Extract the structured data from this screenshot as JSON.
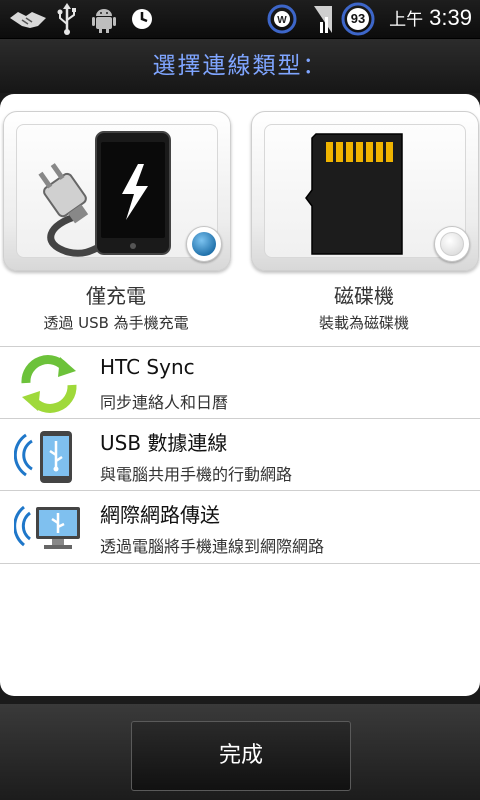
{
  "status_bar": {
    "battery_level": "93",
    "ampm": "上午",
    "time": "3:39",
    "icons": [
      "handshake-icon",
      "usb-icon",
      "android-icon",
      "clock-icon",
      "widget-w-icon",
      "signal-icon",
      "battery-icon"
    ]
  },
  "dialog": {
    "title": "選擇連線類型："
  },
  "tiles": [
    {
      "label": "僅充電",
      "sub": "透過 USB 為手機充電",
      "selected": true,
      "icon": "charging-phone-icon"
    },
    {
      "label": "磁碟機",
      "sub": "裝載為磁碟機",
      "selected": false,
      "icon": "sd-card-icon"
    }
  ],
  "options": [
    {
      "title": "HTC Sync",
      "desc": "同步連絡人和日曆",
      "icon": "sync-arrows-icon"
    },
    {
      "title": "USB 數據連線",
      "desc": "與電腦共用手機的行動網路",
      "icon": "phone-usb-tether-icon"
    },
    {
      "title": "網際網路傳送",
      "desc": "透過電腦將手機連線到網際網路",
      "icon": "computer-usb-passthrough-icon"
    }
  ],
  "colors": {
    "title_text": "#7fa5ff",
    "radio_selected": "#1d6ea8"
  },
  "buttons": {
    "done": "完成"
  }
}
